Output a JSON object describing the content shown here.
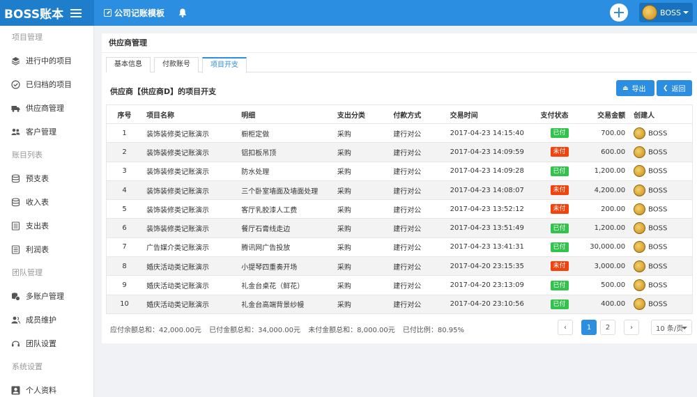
{
  "topbar": {
    "brand": "BOSS账本",
    "template_link": "公司记账模板",
    "user_name": "BOSS"
  },
  "sidebar": {
    "groups": [
      {
        "label": "项目管理",
        "items": [
          {
            "label": "进行中的项目",
            "icon": "layers-icon"
          },
          {
            "label": "已归档的项目",
            "icon": "check-circle-icon"
          },
          {
            "label": "供应商管理",
            "icon": "truck-icon"
          },
          {
            "label": "客户管理",
            "icon": "users-icon"
          }
        ]
      },
      {
        "label": "账目列表",
        "items": [
          {
            "label": "预支表",
            "icon": "database-icon"
          },
          {
            "label": "收入表",
            "icon": "database-icon"
          },
          {
            "label": "支出表",
            "icon": "file-list-icon"
          },
          {
            "label": "利润表",
            "icon": "file-list-icon"
          }
        ]
      },
      {
        "label": "团队管理",
        "items": [
          {
            "label": "多账户管理",
            "icon": "coins-icon"
          },
          {
            "label": "成员维护",
            "icon": "user-group-icon"
          },
          {
            "label": "团队设置",
            "icon": "headset-icon"
          }
        ]
      },
      {
        "label": "系统设置",
        "items": [
          {
            "label": "个人资料",
            "icon": "id-card-icon"
          }
        ]
      }
    ]
  },
  "main": {
    "title": "供应商管理",
    "tabs": [
      "基本信息",
      "付款账号",
      "项目开支"
    ],
    "active_tab": 2,
    "section_title": "供应商【供应商D】的项目开支",
    "export_label": "导出",
    "back_label": "返回",
    "table": {
      "headers": [
        "序号",
        "项目名称",
        "明细",
        "支出分类",
        "付款方式",
        "交易时间",
        "支付状态",
        "交易金额",
        "创建人"
      ],
      "rows": [
        {
          "idx": "1",
          "name": "装饰装修类记账演示",
          "detail": "橱柜定做",
          "category": "采购",
          "pay": "建行对公",
          "time": "2017-04-23 14:15:40",
          "status": "已付",
          "paid": true,
          "amount": "700.00",
          "user": "BOSS"
        },
        {
          "idx": "2",
          "name": "装饰装修类记账演示",
          "detail": "铝扣板吊顶",
          "category": "采购",
          "pay": "建行对公",
          "time": "2017-04-23 14:09:59",
          "status": "未付",
          "paid": false,
          "amount": "600.00",
          "user": "BOSS"
        },
        {
          "idx": "3",
          "name": "装饰装修类记账演示",
          "detail": "防水处理",
          "category": "采购",
          "pay": "建行对公",
          "time": "2017-04-23 14:09:28",
          "status": "已付",
          "paid": true,
          "amount": "1,200.00",
          "user": "BOSS"
        },
        {
          "idx": "4",
          "name": "装饰装修类记账演示",
          "detail": "三个卧室墙面及墙面处理",
          "category": "采购",
          "pay": "建行对公",
          "time": "2017-04-23 14:08:07",
          "status": "未付",
          "paid": false,
          "amount": "4,200.00",
          "user": "BOSS"
        },
        {
          "idx": "5",
          "name": "装饰装修类记账演示",
          "detail": "客厅乳胶漆人工费",
          "category": "采购",
          "pay": "建行对公",
          "time": "2017-04-23 13:52:12",
          "status": "未付",
          "paid": false,
          "amount": "200.00",
          "user": "BOSS"
        },
        {
          "idx": "6",
          "name": "装饰装修类记账演示",
          "detail": "餐厅石膏线走边",
          "category": "采购",
          "pay": "建行对公",
          "time": "2017-04-23 13:51:49",
          "status": "已付",
          "paid": true,
          "amount": "1,200.00",
          "user": "BOSS"
        },
        {
          "idx": "7",
          "name": "广告媒介类记账演示",
          "detail": "腾讯网广告投放",
          "category": "采购",
          "pay": "建行对公",
          "time": "2017-04-23 13:41:31",
          "status": "已付",
          "paid": true,
          "amount": "30,000.00",
          "user": "BOSS"
        },
        {
          "idx": "8",
          "name": "婚庆活动类记账演示",
          "detail": "小提琴四重奏开场",
          "category": "采购",
          "pay": "建行对公",
          "time": "2017-04-20 23:15:35",
          "status": "未付",
          "paid": false,
          "amount": "3,000.00",
          "user": "BOSS"
        },
        {
          "idx": "9",
          "name": "婚庆活动类记账演示",
          "detail": "礼金台桌花（鲜花）",
          "category": "采购",
          "pay": "建行对公",
          "time": "2017-04-20 23:13:09",
          "status": "已付",
          "paid": true,
          "amount": "500.00",
          "user": "BOSS"
        },
        {
          "idx": "10",
          "name": "婚庆活动类记账演示",
          "detail": "礼金台高端背景纱幔",
          "category": "采购",
          "pay": "建行对公",
          "time": "2017-04-20 23:10:56",
          "status": "已付",
          "paid": true,
          "amount": "400.00",
          "user": "BOSS"
        }
      ]
    },
    "summary": {
      "payable": "应付余额总和：42,000.00元",
      "paid": "已付金额总和：34,000.00元",
      "unpaid": "未付金额总和：8,000.00元",
      "ratio": "已付比例：80.95%"
    },
    "pagination": {
      "prev": "‹",
      "pages": [
        "1",
        "2"
      ],
      "current": "1",
      "next": "›",
      "page_size": "10 条/页"
    }
  },
  "colors": {
    "primary": "#2c8ee0",
    "paid": "#32c24d",
    "unpaid": "#f3420c"
  }
}
